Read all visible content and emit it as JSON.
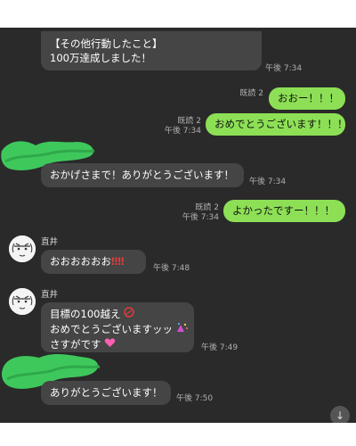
{
  "messages": {
    "m1": {
      "line1": "【その他行動したこと】",
      "line2": "100万達成しました！",
      "time": "午後 7:34"
    },
    "m2": {
      "text": "おおー！！！",
      "read": "既読 2"
    },
    "m3": {
      "text": "おめでとうございます！！！",
      "read": "既読 2",
      "time": "午後 7:34"
    },
    "m4": {
      "text": "おかげさまで！ありがとうございます！",
      "time": "午後 7:34"
    },
    "m5": {
      "text": "よかったですー！！！",
      "read": "既読 2",
      "time": "午後 7:34"
    },
    "m6": {
      "sender": "直井",
      "text": "おおおおおお",
      "bangs": "‼‼",
      "time": "午後 7:48"
    },
    "m7": {
      "sender": "直井",
      "line1": "目標の100越え",
      "line2": "おめでとうございますッッ",
      "line3": "さすがです",
      "time": "午後 7:49"
    },
    "m8": {
      "text": "ありがとうございます！",
      "time": "午後 7:50"
    }
  },
  "icons": {
    "scroll_down": "arrow-down-icon",
    "emoji_100": "hundred-points-icon",
    "emoji_party": "confetti-icon",
    "emoji_heart": "sparkling-heart-icon"
  },
  "colors": {
    "outgoing_bubble": "#8de055",
    "incoming_bubble": "#454545",
    "background": "#2a2a2a",
    "redaction": "#3ec85c"
  }
}
